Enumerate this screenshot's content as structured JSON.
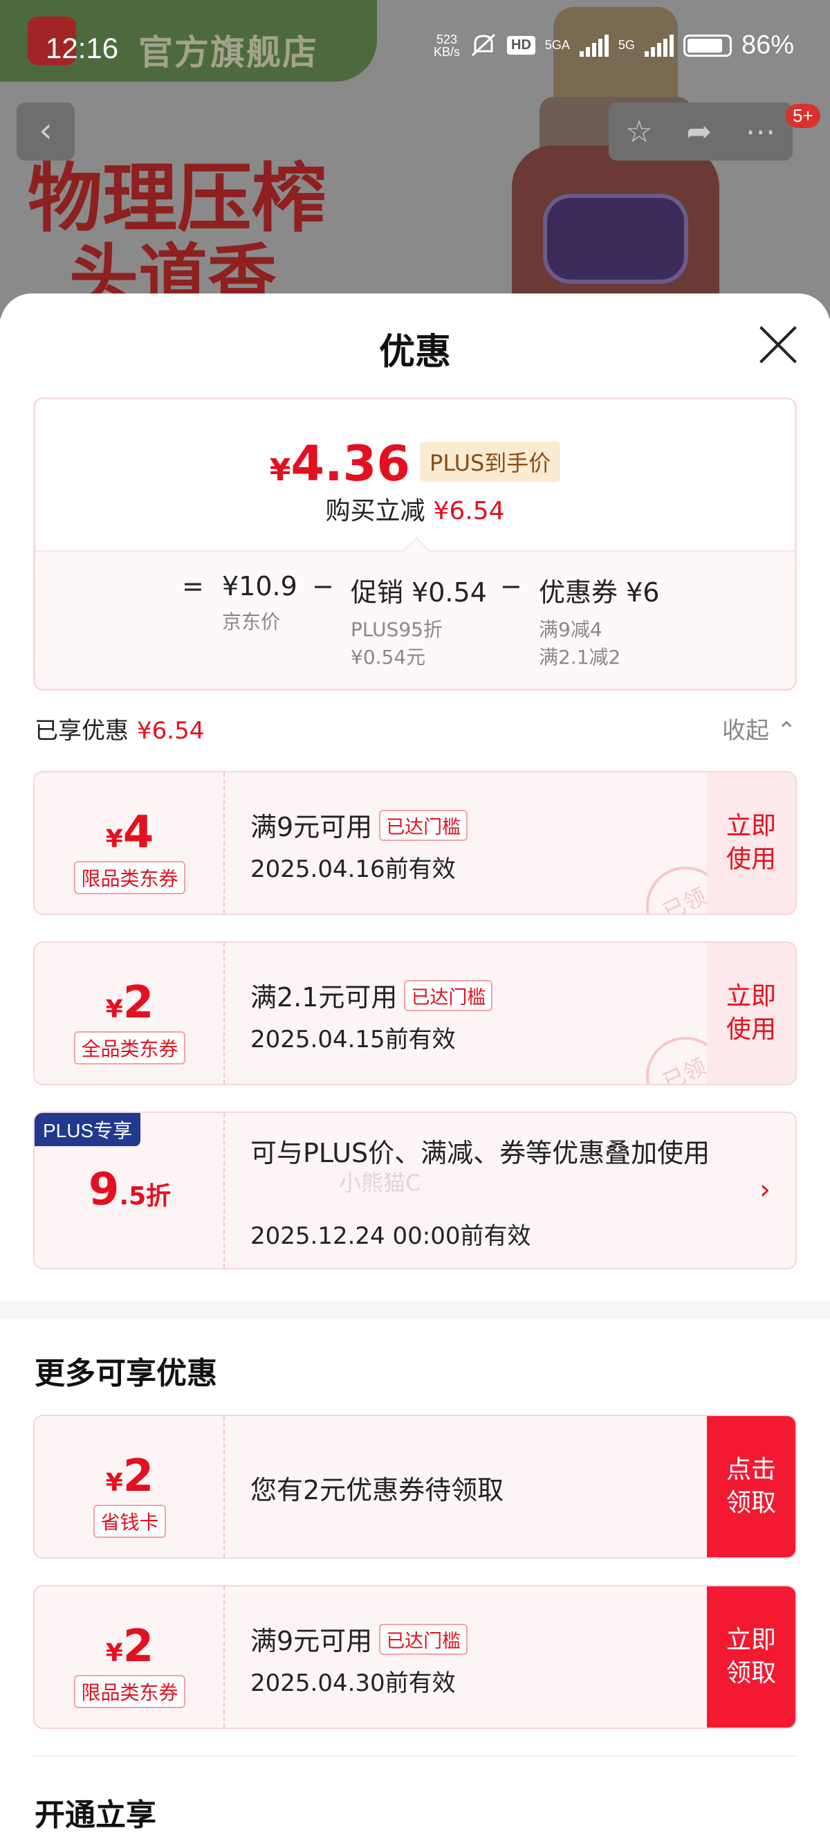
{
  "status_bar": {
    "time": "12:16",
    "speed_value": "523",
    "speed_unit": "KB/s",
    "hd_label": "HD",
    "network_1": "5GA",
    "network_2": "5G",
    "battery_percent": "86%",
    "battery_level": 0.86
  },
  "background": {
    "store_name": "官方旗舰店",
    "slogan_line_1": "物理压榨",
    "slogan_line_2": "头道香",
    "badge_count": "5+"
  },
  "sheet": {
    "title": "优惠",
    "summary": {
      "price_symbol": "¥",
      "price": "4.36",
      "price_tag": "PLUS到手价",
      "save_label": "购买立减",
      "save_value": "¥6.54",
      "equals": "=",
      "minus": "−",
      "jd_price": "¥10.9",
      "jd_price_label": "京东价",
      "promo": "促销 ¥0.54",
      "promo_detail_1": "PLUS95折",
      "promo_detail_2": "¥0.54元",
      "coupon": "优惠券 ¥6",
      "coupon_detail_1": "满9减4",
      "coupon_detail_2": "满2.1减2"
    },
    "enjoyed_label": "已享优惠",
    "enjoyed_value": "¥6.54",
    "collapse_label": "收起",
    "enjoyed_coupons": [
      {
        "currency": "¥",
        "amount": "4",
        "type": "限品类东券",
        "condition": "满9元可用",
        "status": "已达门槛",
        "expiry": "2025.04.16前有效",
        "action": "立即\n使用",
        "stamp": "已领"
      },
      {
        "currency": "¥",
        "amount": "2",
        "type": "全品类东券",
        "condition": "满2.1元可用",
        "status": "已达门槛",
        "expiry": "2025.04.15前有效",
        "action": "立即\n使用",
        "stamp": "已领"
      }
    ],
    "plus_offer": {
      "badge": "PLUS专享",
      "discount_big": "9",
      "discount_small": ".5折",
      "description": "可与PLUS价、满减、券等优惠叠加使用",
      "expiry": "2025.12.24 00:00前有效"
    },
    "watermark": "小熊猫C",
    "more_title": "更多可享优惠",
    "more_coupons": [
      {
        "currency": "¥",
        "amount": "2",
        "type": "省钱卡",
        "text": "您有2元优惠券待领取",
        "action": "点击\n领取"
      },
      {
        "currency": "¥",
        "amount": "2",
        "type": "限品类东券",
        "condition": "满9元可用",
        "status": "已达门槛",
        "expiry": "2025.04.30前有效",
        "action": "立即\n领取"
      }
    ],
    "open_title": "开通立享"
  },
  "colors": {
    "accent_red": "#e4101f",
    "action_red": "#f31931",
    "plus_blue": "#213a8f"
  },
  "icons": [
    "back-arrow-icon",
    "star-icon",
    "share-icon",
    "more-icon",
    "close-icon",
    "chevron-up-icon",
    "chevron-right-icon",
    "mute-icon"
  ]
}
